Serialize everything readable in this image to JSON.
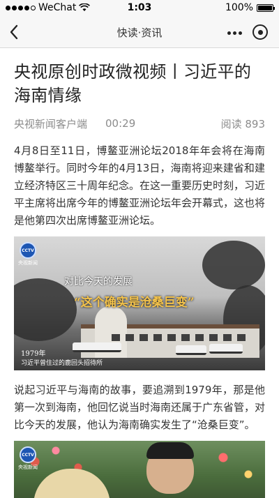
{
  "status_bar": {
    "carrier": "WeChat",
    "time": "1:03",
    "battery": "100%"
  },
  "nav": {
    "title": "快读·资讯"
  },
  "article": {
    "title": "央视原创时政微视频丨习近平的海南情缘",
    "source": "央视新闻客户端",
    "duration": "00:29",
    "reads": "阅读 893",
    "paragraph_1": "4月8日至11日，博鳌亚洲论坛2018年年会将在海南博鳌举行。同时今年的4月13日，海南将迎来建省和建立经济特区三十周年纪念。在这一重要历史时刻，习近平主席将出席今年的博鳌亚洲论坛年会开幕式，这也将是他第四次出席博鳌亚洲论坛。",
    "paragraph_2": "说起习近平与海南的故事，要追溯到1979年，那是他第一次到海南，他回忆说当时海南还属于广东省管，对比今天的发展，他认为海南确实发生了“沧桑巨变”。"
  },
  "figure_1": {
    "logo": "CCTV",
    "logo_text": "央视新闻",
    "caption_top": "对比今天的发展",
    "caption_main": "“这个确实是沧桑巨变”",
    "year": "1979年",
    "subtitle": "习近平曾住过的鹿回头招待所"
  },
  "figure_2": {
    "logo": "CCTV",
    "logo_text": "央视新闻"
  },
  "icons": {
    "back": "chevron-left-icon",
    "more": "more-dots-icon",
    "close": "close-circle-icon",
    "wifi": "wifi-icon",
    "battery": "battery-icon"
  },
  "colors": {
    "caption_gold": "#f3c24b",
    "meta_gray": "#8c8c8c",
    "nav_bg": "#f7f7f7"
  },
  "battery_level": 1.0
}
